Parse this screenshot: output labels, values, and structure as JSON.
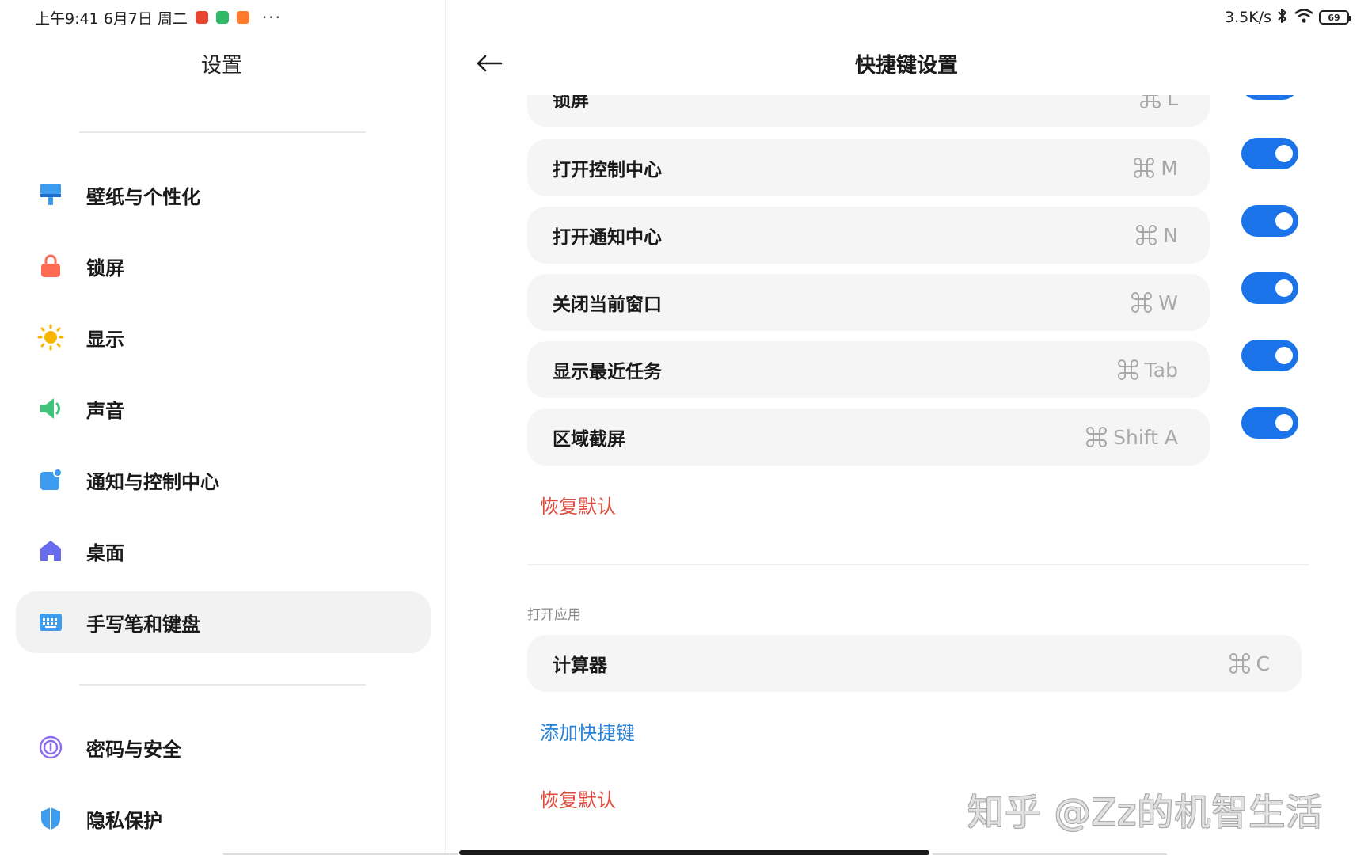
{
  "status_bar": {
    "time_date": "上午9:41 6月7日 周二",
    "dots": "···",
    "net_speed": "3.5K/s",
    "battery": "69",
    "app_colors": [
      "#e8452f",
      "#2fb866",
      "#ff7a2a"
    ]
  },
  "left": {
    "title": "设置",
    "items": [
      {
        "label": "壁纸与个性化",
        "icon": "paintbrush-icon"
      },
      {
        "label": "锁屏",
        "icon": "lock-icon"
      },
      {
        "label": "显示",
        "icon": "sun-icon"
      },
      {
        "label": "声音",
        "icon": "speaker-icon"
      },
      {
        "label": "通知与控制中心",
        "icon": "notification-icon"
      },
      {
        "label": "桌面",
        "icon": "home-icon"
      },
      {
        "label": "手写笔和键盘",
        "icon": "keyboard-icon",
        "selected": true
      },
      {
        "label": "密码与安全",
        "icon": "fingerprint-icon"
      },
      {
        "label": "隐私保护",
        "icon": "privacy-shield-icon"
      }
    ]
  },
  "right": {
    "title": "快捷键设置",
    "shortcuts": [
      {
        "label": "锁屏",
        "keys": "L",
        "enabled": true
      },
      {
        "label": "打开控制中心",
        "keys": "M",
        "enabled": true
      },
      {
        "label": "打开通知中心",
        "keys": "N",
        "enabled": true
      },
      {
        "label": "关闭当前窗口",
        "keys": "W",
        "enabled": true
      },
      {
        "label": "显示最近任务",
        "keys": "Tab",
        "enabled": true
      },
      {
        "label": "区域截屏",
        "keys": "Shift A",
        "enabled": true
      }
    ],
    "restore_default_1": "恢复默认",
    "section_open_apps": "打开应用",
    "app_shortcuts": [
      {
        "label": "计算器",
        "keys": "C"
      }
    ],
    "add_shortcut": "添加快捷键",
    "restore_default_2": "恢复默认"
  },
  "watermark": "知乎 @Zz的机智生活",
  "colors": {
    "accent_blue": "#1a73e8",
    "link_red": "#e04a3c",
    "link_blue": "#2a84d6"
  }
}
